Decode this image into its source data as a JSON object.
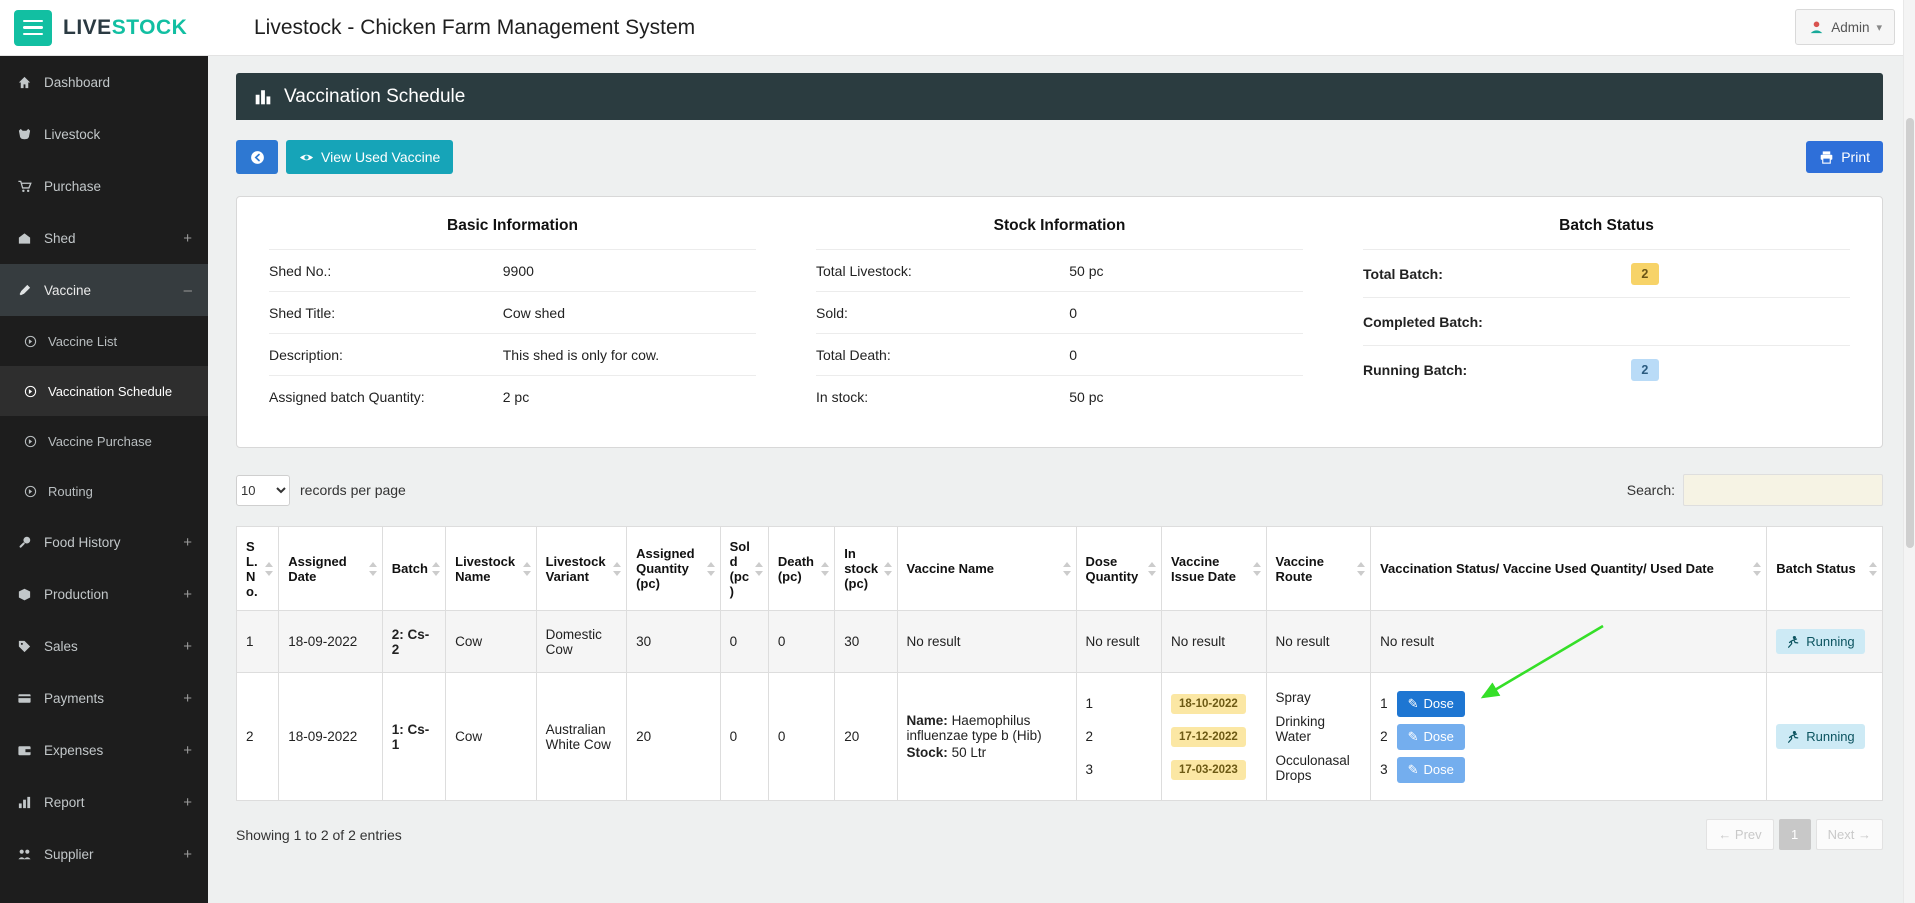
{
  "icons": {
    "pencil": "✎",
    "caret_down": "▾"
  },
  "topbar": {
    "logo_live": "LIVE",
    "logo_stock": "STOCK",
    "page_title": "Livestock - Chicken Farm Management System",
    "admin": "Admin"
  },
  "sidebar": {
    "items": [
      {
        "label": "Dashboard"
      },
      {
        "label": "Livestock"
      },
      {
        "label": "Purchase"
      },
      {
        "label": "Shed",
        "plus": "+"
      },
      {
        "label": "Vaccine",
        "plus": "–"
      },
      {
        "label": "Food History",
        "plus": "+"
      },
      {
        "label": "Production",
        "plus": "+"
      },
      {
        "label": "Sales",
        "plus": "+"
      },
      {
        "label": "Payments",
        "plus": "+"
      },
      {
        "label": "Expenses",
        "plus": "+"
      },
      {
        "label": "Report",
        "plus": "+"
      },
      {
        "label": "Supplier",
        "plus": "+"
      }
    ],
    "vaccine_children": [
      {
        "label": "Vaccine List"
      },
      {
        "label": "Vaccination Schedule"
      },
      {
        "label": "Vaccine Purchase"
      },
      {
        "label": "Routing"
      }
    ]
  },
  "panel": {
    "title": "Vaccination Schedule"
  },
  "actions": {
    "view_used_vaccine": "View Used Vaccine",
    "print": "Print"
  },
  "info": {
    "basic": {
      "title": "Basic Information",
      "rows": [
        {
          "label": "Shed No.:",
          "value": "9900"
        },
        {
          "label": "Shed Title:",
          "value": "Cow shed"
        },
        {
          "label": "Description:",
          "value": "This shed is only for cow."
        },
        {
          "label": "Assigned batch Quantity:",
          "value": "2 pc"
        }
      ]
    },
    "stock": {
      "title": "Stock Information",
      "rows": [
        {
          "label": "Total Livestock:",
          "value": "50 pc"
        },
        {
          "label": "Sold:",
          "value": "0"
        },
        {
          "label": "Total Death:",
          "value": "0"
        },
        {
          "label": "In stock:",
          "value": "50 pc"
        }
      ]
    },
    "batch": {
      "title": "Batch Status",
      "rows": [
        {
          "label": "Total Batch:",
          "badge": "2"
        },
        {
          "label": "Completed Batch:",
          "badge": ""
        },
        {
          "label": "Running Batch:",
          "badge": "2"
        }
      ]
    }
  },
  "controls": {
    "page_size": "10",
    "records_label": "records per page",
    "search_label": "Search:",
    "search_value": ""
  },
  "table": {
    "headers": [
      "SL. No.",
      "Assigned Date",
      "Batch",
      "Livestock Name",
      "Livestock Variant",
      "Assigned Quantity (pc)",
      "Sold (pc)",
      "Death (pc)",
      "In stock (pc)",
      "Vaccine Name",
      "Dose Quantity",
      "Vaccine Issue Date",
      "Vaccine Route",
      "Vaccination Status/ Vaccine Used Quantity/ Used Date",
      "Batch Status"
    ],
    "no_result": "No result",
    "rows": [
      {
        "sl": "1",
        "assigned_date": "18-09-2022",
        "batch": "2: Cs-2",
        "livestock_name": "Cow",
        "variant": "Domestic Cow",
        "assigned_qty": "30",
        "sold": "0",
        "death": "0",
        "in_stock": "30",
        "batch_status": "Running"
      },
      {
        "sl": "2",
        "assigned_date": "18-09-2022",
        "batch": "1: Cs-1",
        "livestock_name": "Cow",
        "variant": "Australian White Cow",
        "assigned_qty": "20",
        "sold": "0",
        "death": "0",
        "in_stock": "20",
        "vaccine_name_label": "Name:",
        "vaccine_name": "Haemophilus influenzae type b (Hib)",
        "vaccine_stock_label": "Stock:",
        "vaccine_stock": "50 Ltr",
        "dose_numbers": [
          "1",
          "2",
          "3"
        ],
        "issue_dates": [
          "18-10-2022",
          "17-12-2022",
          "17-03-2023"
        ],
        "routes": [
          "Spray",
          "Drinking Water",
          "Occulonasal Drops"
        ],
        "dose_button_label": "Dose",
        "batch_status": "Running"
      }
    ]
  },
  "footer": {
    "showing": "Showing 1 to 2 of 2 entries",
    "prev": "← Prev",
    "page": "1",
    "next": "Next →"
  }
}
